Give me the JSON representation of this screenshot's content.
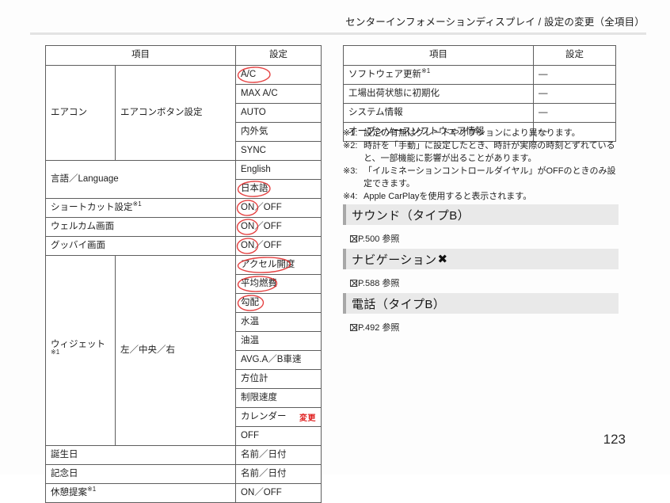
{
  "header": {
    "title": "センターインフォメーションディスプレイ / 設定の変更（全項目）"
  },
  "left_table": {
    "headers": {
      "item": "項目",
      "setting": "設定"
    },
    "rows": [
      {
        "group": "エアコン",
        "sub": "エアコンボタン設定",
        "setting": "A/C",
        "circled": true
      },
      {
        "group": "",
        "sub": "",
        "setting": "MAX A/C",
        "circled": false
      },
      {
        "group": "",
        "sub": "",
        "setting": "AUTO",
        "circled": false
      },
      {
        "group": "",
        "sub": "",
        "setting": "内外気",
        "circled": false
      },
      {
        "group": "",
        "sub": "",
        "setting": "SYNC",
        "circled": false
      },
      {
        "group": "言語／Language",
        "sub": "",
        "setting": "English",
        "circled": false
      },
      {
        "group": "",
        "sub": "",
        "setting": "日本語",
        "circled": true
      },
      {
        "group": "ショートカット設定",
        "note": "※1",
        "sub": "",
        "setting": "ON／OFF",
        "circled": true
      },
      {
        "group": "ウェルカム画面",
        "sub": "",
        "setting": "ON／OFF",
        "circled": true
      },
      {
        "group": "グッバイ画面",
        "sub": "",
        "setting": "ON／OFF",
        "circled": true
      },
      {
        "group": "ウィジェット",
        "note": "※1",
        "sub": "左／中央／右",
        "setting": "アクセル開度",
        "circled": true
      },
      {
        "group": "",
        "sub": "",
        "setting": "平均燃費",
        "circled": true
      },
      {
        "group": "",
        "sub": "",
        "setting": "勾配",
        "circled": true
      },
      {
        "group": "",
        "sub": "",
        "setting": "水温",
        "circled": false
      },
      {
        "group": "",
        "sub": "",
        "setting": "油温",
        "circled": false
      },
      {
        "group": "",
        "sub": "",
        "setting": "AVG.A／B車速",
        "circled": false
      },
      {
        "group": "",
        "sub": "",
        "setting": "方位計",
        "circled": false
      },
      {
        "group": "",
        "sub": "",
        "setting": "制限速度",
        "circled": false
      },
      {
        "group": "",
        "sub": "",
        "setting": "カレンダー",
        "circled": false
      },
      {
        "group": "",
        "sub": "",
        "setting": "OFF",
        "circled": false
      },
      {
        "group": "誕生日",
        "sub": "",
        "setting": "名前／日付",
        "circled": false
      },
      {
        "group": "記念日",
        "sub": "",
        "setting": "名前／日付",
        "circled": false
      },
      {
        "group": "休憩提案",
        "note": "※1",
        "sub": "",
        "setting": "ON／OFF",
        "circled": true
      }
    ],
    "annotation_label": "変更"
  },
  "right_table": {
    "headers": {
      "item": "項目",
      "setting": "設定"
    },
    "rows": [
      {
        "item": "ソフトウェア更新",
        "note": "※1",
        "setting": "—"
      },
      {
        "item": "工場出荷状態に初期化",
        "note": "",
        "setting": "—"
      },
      {
        "item": "システム情報",
        "note": "",
        "setting": "—"
      },
      {
        "item": "オープンソースソフトウェア情報",
        "note": "",
        "setting": "—"
      }
    ]
  },
  "footnotes": [
    {
      "mark": "※1:",
      "text": "設定の有無はグレードやオプションにより異なります。"
    },
    {
      "mark": "※2:",
      "text": "時計を「手動」に設定したとき、時計が実際の時刻とずれていると、一部機能に影響が出ることがあります。"
    },
    {
      "mark": "※3:",
      "text": "「イルミネーションコントロールダイヤル」がOFFのときのみ設定できます。"
    },
    {
      "mark": "※4:",
      "text": "Apple CarPlayを使用すると表示されます。"
    }
  ],
  "sections": [
    {
      "title": "サウンド（タイプB）",
      "icon": "",
      "reference": "P.500  参照"
    },
    {
      "title": "ナビゲーション",
      "icon": "✖",
      "reference": "P.588  参照"
    },
    {
      "title": "電話（タイプB）",
      "icon": "",
      "reference": "P.492  参照"
    }
  ],
  "page_number": "123",
  "colors": {
    "annotation_red": "#e02020",
    "section_bar": "#e9e9e9",
    "section_bar_accent": "#a8a8a8",
    "table_border": "#5e5e5e"
  }
}
